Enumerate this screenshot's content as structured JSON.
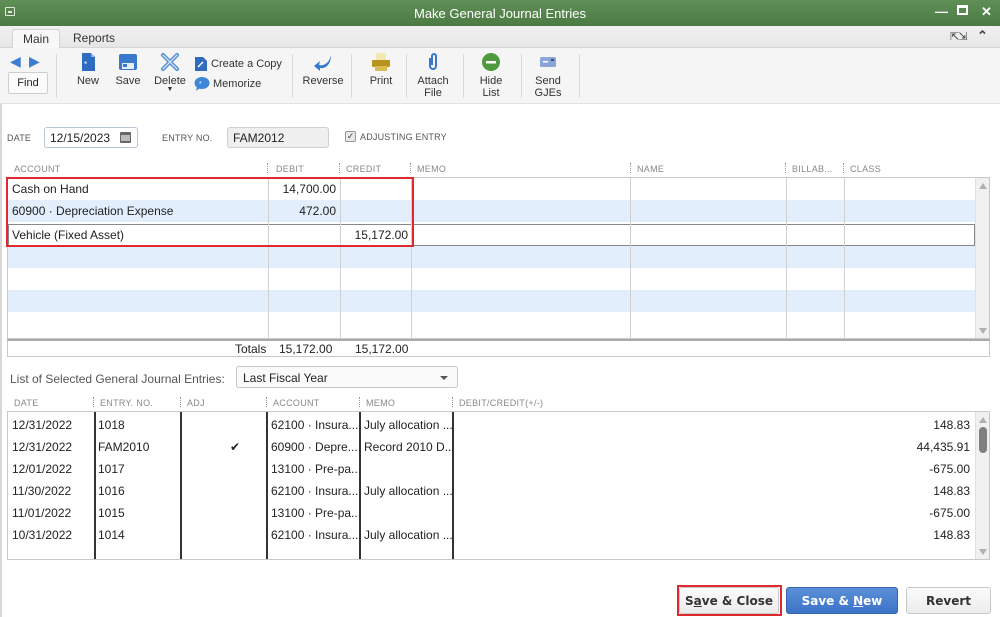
{
  "window": {
    "title": "Make General Journal Entries",
    "controls": [
      "minimize",
      "maximize",
      "close"
    ]
  },
  "ribbon": {
    "tabs": [
      {
        "label": "Main",
        "active": true
      },
      {
        "label": "Reports",
        "active": false
      }
    ],
    "right_icons": [
      "fullscreen-icon",
      "collapse-ribbon-icon"
    ]
  },
  "toolbar": {
    "find_label": "Find",
    "new_label": "New",
    "save_label": "Save",
    "delete_label": "Delete",
    "create_copy_label": "Create a Copy",
    "memorize_label": "Memorize",
    "reverse_label": "Reverse",
    "print_label": "Print",
    "attach_line1": "Attach",
    "attach_line2": "File",
    "hide_line1": "Hide",
    "hide_line2": "List",
    "send_line1": "Send",
    "send_line2": "GJEs"
  },
  "form": {
    "date_label": "DATE",
    "date_value": "12/15/2023",
    "entry_no_label": "ENTRY NO.",
    "entry_no_value": "FAM2012",
    "adjusting_label": "ADJUSTING ENTRY",
    "adjusting_checked": true
  },
  "grid": {
    "headers": {
      "account": "ACCOUNT",
      "debit": "DEBIT",
      "credit": "CREDIT",
      "memo": "MEMO",
      "name": "NAME",
      "billable": "BILLAB...",
      "class": "CLASS"
    },
    "rows": [
      {
        "account": "Cash on Hand",
        "debit": "14,700.00",
        "credit": "",
        "memo": "",
        "name": "",
        "billable": "",
        "class": ""
      },
      {
        "account": "60900 · Depreciation Expense",
        "debit": "472.00",
        "credit": "",
        "memo": "",
        "name": "",
        "billable": "",
        "class": ""
      },
      {
        "account": "Vehicle (Fixed Asset)",
        "debit": "",
        "credit": "15,172.00",
        "memo": "",
        "name": "",
        "billable": "",
        "class": ""
      }
    ],
    "totals_label": "Totals",
    "total_debit": "15,172.00",
    "total_credit": "15,172.00"
  },
  "list": {
    "label": "List of Selected General Journal Entries:",
    "filter_value": "Last Fiscal Year",
    "headers": {
      "date": "DATE",
      "entry_no": "ENTRY. NO.",
      "adj": "ADJ",
      "account": "ACCOUNT",
      "memo": "MEMO",
      "amount": "DEBIT/CREDIT(+/-)"
    },
    "rows": [
      {
        "date": "12/31/2022",
        "entry_no": "1018",
        "adj": "",
        "account": "62100 · Insura...",
        "memo": "July allocation ...",
        "amount": "148.83"
      },
      {
        "date": "12/31/2022",
        "entry_no": "FAM2010",
        "adj": "✔",
        "account": "60900 · Depre...",
        "memo": "Record 2010 D...",
        "amount": "44,435.91"
      },
      {
        "date": "12/01/2022",
        "entry_no": "1017",
        "adj": "",
        "account": "13100 · Pre-pa...",
        "memo": "",
        "amount": "-675.00"
      },
      {
        "date": "11/30/2022",
        "entry_no": "1016",
        "adj": "",
        "account": "62100 · Insura...",
        "memo": "July allocation ...",
        "amount": "148.83"
      },
      {
        "date": "11/01/2022",
        "entry_no": "1015",
        "adj": "",
        "account": "13100 · Pre-pa...",
        "memo": "",
        "amount": "-675.00"
      },
      {
        "date": "10/31/2022",
        "entry_no": "1014",
        "adj": "",
        "account": "62100 · Insura...",
        "memo": "July allocation ...",
        "amount": "148.83"
      }
    ]
  },
  "buttons": {
    "save_close_pre": "S",
    "save_close_u": "a",
    "save_close_post": "ve & Close",
    "save_new_pre": "Save & ",
    "save_new_u": "N",
    "save_new_post": "ew",
    "revert": "Revert"
  },
  "colors": {
    "titlebar": "#4c7a44",
    "highlight_box": "#e0292e",
    "alt_row": "#e2eefb",
    "primary_button": "#3d73c8"
  }
}
